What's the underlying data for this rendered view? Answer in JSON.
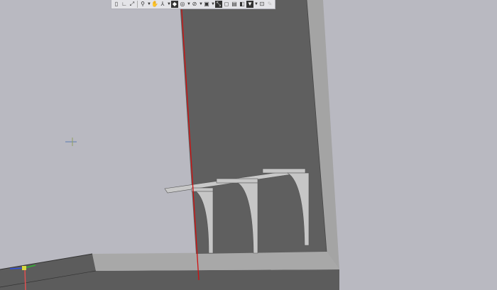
{
  "toolbar": {
    "buttons": [
      {
        "icon": "panel-icon"
      },
      {
        "icon": "orientation-icon"
      },
      {
        "icon": "zoom-fit-icon"
      },
      {
        "icon": "zoom-icon",
        "dropdown": true
      },
      {
        "icon": "pan-icon"
      },
      {
        "icon": "rotate-icon",
        "dropdown": true
      },
      {
        "icon": "shaded-display-icon",
        "active": true
      },
      {
        "icon": "display-mode-icon",
        "dropdown": true
      },
      {
        "icon": "hide-icon",
        "dropdown": true
      },
      {
        "icon": "section-icon",
        "dropdown": true
      },
      {
        "icon": "perspective-icon",
        "active": true
      },
      {
        "icon": "frame-icon"
      },
      {
        "icon": "layers-icon"
      },
      {
        "icon": "properties-icon"
      },
      {
        "icon": "filter-icon",
        "active": true,
        "dropdown": true
      },
      {
        "icon": "snap-icon"
      },
      {
        "icon": "pencil-icon"
      }
    ]
  },
  "colors": {
    "background": "#b9b9c1",
    "wall_face": "#5f5f5f",
    "wall_side": "#a4a4a4",
    "floor_top": "#a8a8a8",
    "section_line": "#d01010",
    "axis_x": "#e05050",
    "axis_y": "#30b030",
    "axis_z": "#3050e0"
  }
}
